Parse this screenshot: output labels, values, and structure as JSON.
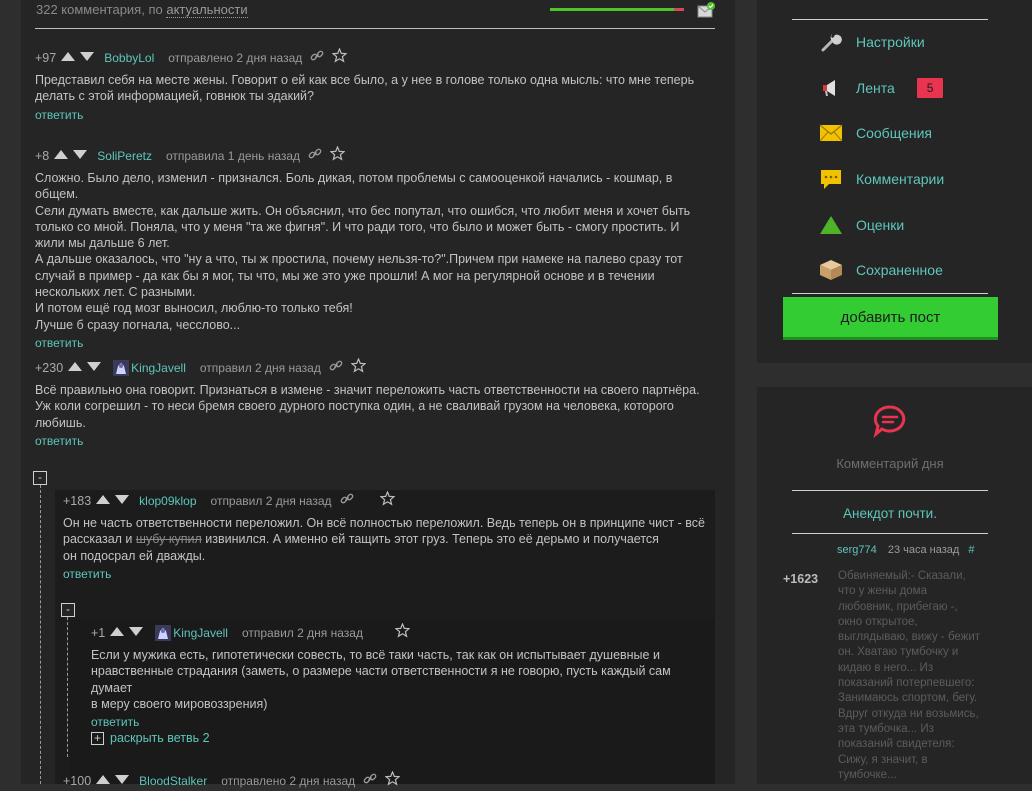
{
  "header": {
    "count_text": "322 комментария, по",
    "sort_label": "актуальности"
  },
  "comments": [
    {
      "rating": "+97",
      "author": "BobbyLol",
      "sent": "отправлено 2 дня назад",
      "text": "Представил себя на месте жены. Говорит о ей как все было, а у нее в голове только одна мысль: что мне теперь делать с этой информацией, говнюк ты эдакий?",
      "reply": "ответить"
    },
    {
      "rating": "+8",
      "author": "SoliPeretz",
      "sent": "отправила 1 день назад",
      "text_lines": [
        "Сложно. Было дело, изменил - признался. Боль дикая, потом проблемы с самооценкой начались - кошмар, в общем.",
        "Сели думать вместе, как дальше жить. Он объяснил, что бес попутал, что ошибся, что любит меня и хочет быть",
        "только со мной. Поняла, что у меня \"та же фигня\". И что ради того, что было и может быть - смогу простить. И",
        "жили мы дальше 6 лет.",
        "А дальше оказалось, что \"ну а что, ты ж простила, почему нельзя-то?\".Причем при намеке на палево сразу тот",
        "случай в пример - да как бы я мог, ты что, мы же это уже прошли! А мог на регулярной основе и в течении",
        "нескольких лет. С разными.",
        "И потом ещё год мозг выносил, люблю-то только тебя!",
        "Лучше б сразу погнала, чесслово..."
      ],
      "reply": "ответить"
    },
    {
      "rating": "+230",
      "author": "KingJavell",
      "sent": "отправил 2 дня назад",
      "text_lines": [
        "Всё правильно она говорит. Признаться в измене - значит переложить часть ответственности на своего партнёра.",
        "Уж коли согрешил - то неси бремя своего дурного поступка один, а не сваливай грузом на человека, которого",
        "любишь."
      ],
      "reply": "ответить"
    },
    {
      "rating": "+183",
      "author": "klop09klop",
      "sent": "отправил 2 дня назад",
      "text_line1": "Он не часть ответственности переложил. Он всё полностью переложил. Ведь теперь он в принципе чист - всё",
      "text_line2_pre": "рассказал и ",
      "text_line2_strike": "шубу купил",
      "text_line2_post": " извинился. А именно ей тащить этот груз. Теперь это её дерьмо и получается",
      "text_line3": "он подосрал ей дважды.",
      "reply": "ответить"
    },
    {
      "rating": "+1",
      "author": "KingJavell",
      "sent": "отправил 2 дня назад",
      "text_lines": [
        "Если у мужика есть, гипотетически совесть, то всё таки часть, так как он испытывает душевные и",
        "нравственные страдания (заметь, о размере части ответственности я не говорю, пусть каждый сам думает",
        "в меру своего мировоззрения)"
      ],
      "reply": "ответить"
    },
    {
      "rating": "+100",
      "author": "BloodStalker",
      "sent": "отправлено 2 дня назад"
    }
  ],
  "expand_branch": "раскрыть ветвь 2",
  "toggle_symbol": "-",
  "menu": {
    "items": [
      {
        "label": "Настройки",
        "icon": "wrench-icon"
      },
      {
        "label": "Лента",
        "icon": "megaphone-icon",
        "badge": "5"
      },
      {
        "label": "Сообщения",
        "icon": "envelope-icon"
      },
      {
        "label": "Комментарии",
        "icon": "speech-bubble-icon"
      },
      {
        "label": "Оценки",
        "icon": "triangle-icon"
      },
      {
        "label": "Сохраненное",
        "icon": "box-icon"
      }
    ],
    "add_post": "добавить пост"
  },
  "comment_of_day": {
    "title": "Комментарий дня",
    "post_title": "Анекдот почти.",
    "author": "serg774",
    "time": "23 часа назад",
    "hash": "#",
    "rating": "+1623",
    "text_lines": [
      "Обвиняемый:- Сказали,",
      "что у жены дома",
      "любовник, прибегаю -,",
      "окно открытое,",
      "выглядываю, вижу - бежит",
      "он. Хватаю тумбочку и",
      "кидаю в него... Из",
      "показаний потерпевшего:",
      "Занимаюсь спортом, бегу.",
      "Вдруг откуда ни возьмись,",
      "эта тумбочка... Из",
      "показаний свидетеля:",
      "Сижу, я значит, в",
      "тумбочке..."
    ]
  },
  "colors": {
    "accent": "#5ec6bb",
    "panel": "#252525",
    "background": "#2e2e2e",
    "add_button": "#33cc33",
    "badge": "#e8344e"
  }
}
